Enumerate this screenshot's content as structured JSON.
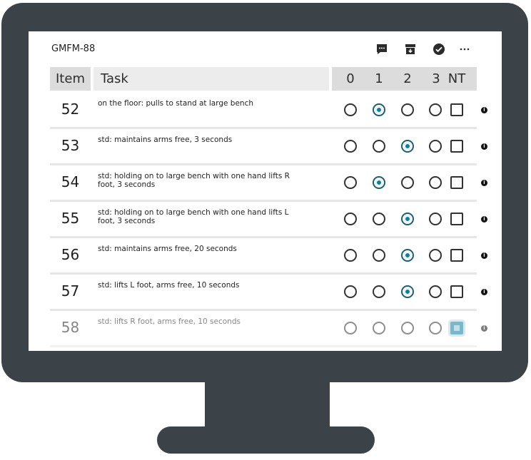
{
  "app": {
    "title": "GMFM-88"
  },
  "toolbar": {
    "comment_icon": "comment-icon",
    "archive_icon": "archive-icon",
    "complete_icon": "check-circle-icon",
    "more_icon": "more-icon"
  },
  "table": {
    "headers": {
      "item": "Item",
      "task": "Task",
      "score_0": "0",
      "score_1": "1",
      "score_2": "2",
      "score_3": "3",
      "nt": "NT"
    },
    "rows": [
      {
        "item": "52",
        "task": "on the floor: pulls to stand at large bench",
        "score": 1,
        "nt": false,
        "faded": false
      },
      {
        "item": "53",
        "task": "std: maintains arms free, 3 seconds",
        "score": 2,
        "nt": false,
        "faded": false
      },
      {
        "item": "54",
        "task": "std: holding on to large bench with one hand lifts R foot, 3 seconds",
        "score": 1,
        "nt": false,
        "faded": false
      },
      {
        "item": "55",
        "task": "std: holding on to large bench with one hand lifts L foot, 3 seconds",
        "score": 2,
        "nt": false,
        "faded": false
      },
      {
        "item": "56",
        "task": "std: maintains arms free, 20 seconds",
        "score": 2,
        "nt": false,
        "faded": false
      },
      {
        "item": "57",
        "task": "std: lifts L foot, arms free, 10 seconds",
        "score": 2,
        "nt": false,
        "faded": false
      },
      {
        "item": "58",
        "task": "std: lifts R foot, arms free, 10 seconds",
        "score": null,
        "nt": true,
        "faded": true
      }
    ]
  },
  "colors": {
    "accent": "#0b7fa0",
    "frame": "#3c4348"
  }
}
